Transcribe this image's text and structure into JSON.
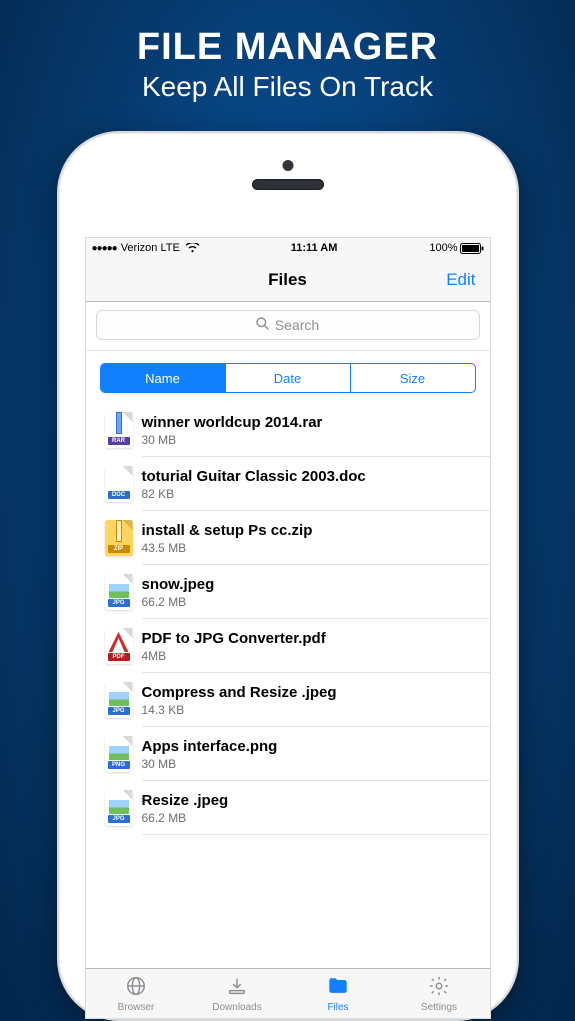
{
  "promo": {
    "title": "FILE MANAGER",
    "subtitle": "Keep All Files On Track"
  },
  "status": {
    "carrier": "Verizon LTE",
    "time": "11:11 AM",
    "battery": "100%"
  },
  "nav": {
    "title": "Files",
    "edit_label": "Edit"
  },
  "search": {
    "placeholder": "Search"
  },
  "segments": {
    "options": [
      "Name",
      "Date",
      "Size"
    ],
    "active_index": 0
  },
  "files": [
    {
      "name": "winner worldcup 2014.rar",
      "size": "30 MB",
      "type": "rar"
    },
    {
      "name": "toturial Guitar Classic 2003.doc",
      "size": "82 KB",
      "type": "doc"
    },
    {
      "name": "install & setup Ps cc.zip",
      "size": "43.5 MB",
      "type": "zip"
    },
    {
      "name": "snow.jpeg",
      "size": "66.2 MB",
      "type": "jpg"
    },
    {
      "name": "PDF to JPG Converter.pdf",
      "size": "4MB",
      "type": "pdf"
    },
    {
      "name": "Compress and Resize .jpeg",
      "size": "14.3 KB",
      "type": "jpg"
    },
    {
      "name": "Apps interface.png",
      "size": "30 MB",
      "type": "png"
    },
    {
      "name": "Resize .jpeg",
      "size": "66.2 MB",
      "type": "jpg"
    }
  ],
  "tabs": [
    {
      "label": "Browser",
      "icon": "globe-icon"
    },
    {
      "label": "Downloads",
      "icon": "download-icon"
    },
    {
      "label": "Files",
      "icon": "folder-icon"
    },
    {
      "label": "Settings",
      "icon": "gear-icon"
    }
  ],
  "active_tab_index": 2
}
